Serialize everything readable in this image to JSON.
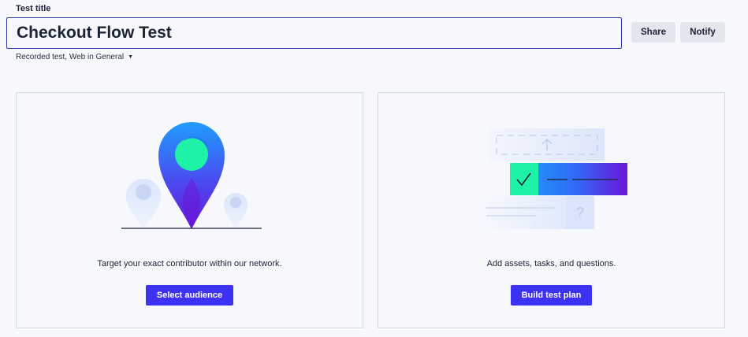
{
  "header": {
    "field_label": "Test title",
    "title_value": "Checkout Flow Test",
    "share_label": "Share",
    "notify_label": "Notify",
    "meta_text": "Recorded test, Web in General"
  },
  "cards": [
    {
      "description": "Target your exact contributor within our network.",
      "button_label": "Select audience"
    },
    {
      "description": "Add assets, tasks, and questions.",
      "button_label": "Build test plan"
    }
  ],
  "colors": {
    "accent": "#3d31f2",
    "title_border": "#2a3aa8",
    "background": "#f6f8fb",
    "teal": "#1ef2a7",
    "blue": "#2f8cff",
    "purple": "#6a16d9"
  },
  "icons": {
    "dropdown": "caret-down-icon",
    "audience_illustration": "location-pins-illustration",
    "plan_illustration": "test-plan-illustration"
  }
}
